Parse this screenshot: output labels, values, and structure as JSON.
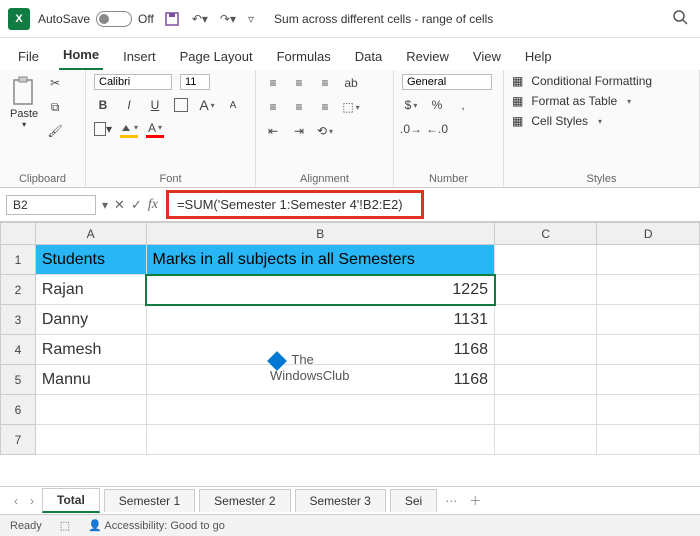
{
  "titlebar": {
    "autosave_label": "AutoSave",
    "autosave_state": "Off",
    "doc_title": "Sum across different cells - range of cells"
  },
  "menu": {
    "file": "File",
    "home": "Home",
    "insert": "Insert",
    "page_layout": "Page Layout",
    "formulas": "Formulas",
    "data": "Data",
    "review": "Review",
    "view": "View",
    "help": "Help"
  },
  "ribbon": {
    "clipboard": {
      "label": "Clipboard",
      "paste": "Paste"
    },
    "font": {
      "label": "Font",
      "name": "Calibri",
      "size": "11",
      "bold": "B",
      "italic": "I",
      "underline": "U",
      "a_inc": "A",
      "a_dec": "A"
    },
    "alignment": {
      "label": "Alignment",
      "wrap": "ab"
    },
    "number": {
      "label": "Number",
      "format": "General",
      "percent": "%",
      "comma": ","
    },
    "styles": {
      "label": "Styles",
      "cond": "Conditional Formatting",
      "table": "Format as Table",
      "cell": "Cell Styles"
    }
  },
  "formula_bar": {
    "cell_ref": "B2",
    "formula": "=SUM('Semester 1:Semester 4'!B2:E2)"
  },
  "grid": {
    "headers": {
      "A": "Students",
      "B": "Marks in all subjects in all Semesters"
    },
    "rows": [
      {
        "a": "Rajan",
        "b": "1225"
      },
      {
        "a": "Danny",
        "b": "1131"
      },
      {
        "a": "Ramesh",
        "b": "1168"
      },
      {
        "a": "Mannu",
        "b": "1168"
      }
    ],
    "cols": [
      "A",
      "B",
      "C",
      "D"
    ],
    "row_nums": [
      "1",
      "2",
      "3",
      "4",
      "5",
      "6",
      "7"
    ]
  },
  "watermark": {
    "line1": "The",
    "line2": "WindowsClub"
  },
  "sheets": {
    "tabs": [
      "Total",
      "Semester 1",
      "Semester 2",
      "Semester 3",
      "Sei"
    ],
    "active": 0
  },
  "status": {
    "ready": "Ready",
    "access": "Accessibility: Good to go"
  }
}
